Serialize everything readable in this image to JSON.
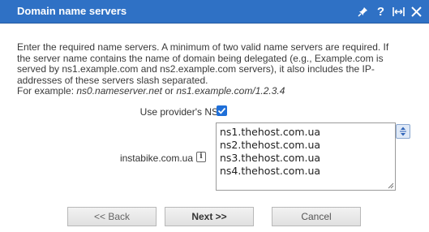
{
  "dialog": {
    "title": "Domain name servers",
    "title_bar_color": "#2f71c5",
    "tools": [
      "pin-icon",
      "help-icon",
      "expand-icon",
      "close-icon"
    ],
    "tool_glyphs": {
      "help": "?"
    }
  },
  "description": {
    "line1": "Enter the required name servers. A minimum of two valid name servers are required. If",
    "line2": "the server name contains the name of domain being delegated (e.g., Example.com is",
    "line3": "served by ns1.example.com and ns2.example.com servers), it also includes the IP-",
    "line4": "addresses of these servers slash separated.",
    "example_prefix": "For example: ",
    "example1": "ns0.nameserver.net",
    "example_or": " or ",
    "example2": "ns1.example.com/1.2.3.4"
  },
  "form": {
    "use_provider_ns_label": "Use provider's NS",
    "use_provider_ns_checked": true,
    "domain_label": "instabike.com.ua",
    "info_icon_glyph": "i",
    "nameservers": [
      "ns1.thehost.com.ua",
      "ns2.thehost.com.ua",
      "ns3.thehost.com.ua",
      "ns4.thehost.com.ua"
    ]
  },
  "buttons": {
    "back": "<< Back",
    "next": "Next >>",
    "cancel": "Cancel"
  }
}
